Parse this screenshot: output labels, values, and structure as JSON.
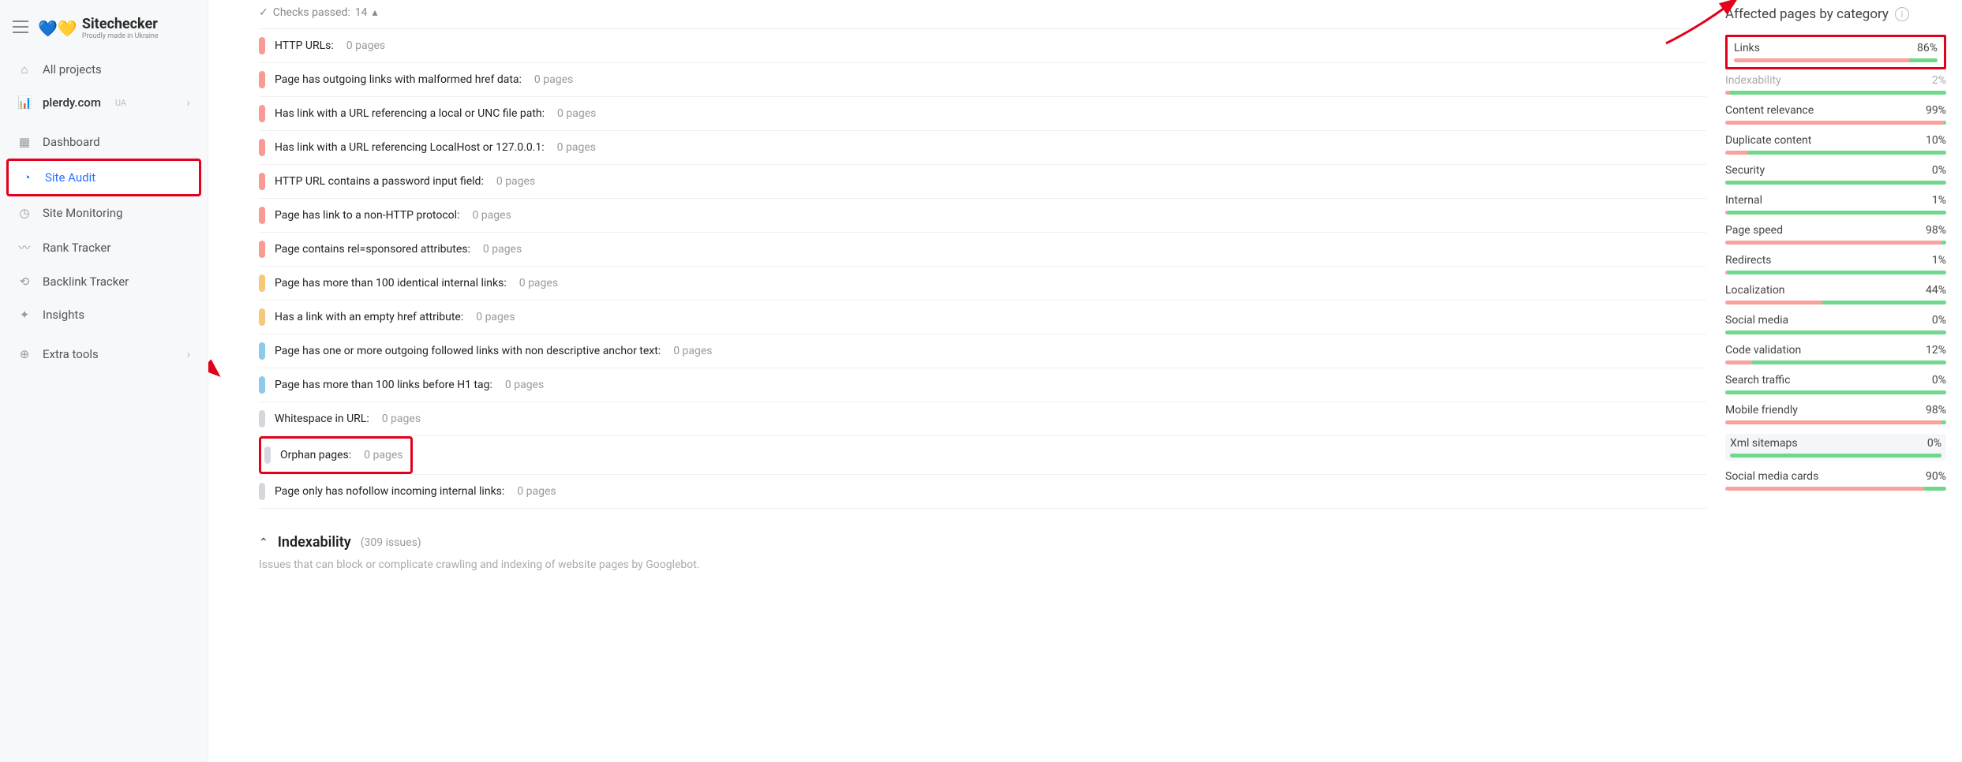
{
  "logo": {
    "title": "Sitechecker",
    "subtitle": "Proudly made in Ukraine"
  },
  "sidebar": {
    "all_projects": "All projects",
    "domain": "plerdy.com",
    "domain_tag": "UA",
    "items": [
      {
        "label": "Dashboard",
        "icon": "grid-icon"
      },
      {
        "label": "Site Audit",
        "icon": "gauge-icon",
        "active": true,
        "highlight": true
      },
      {
        "label": "Site Monitoring",
        "icon": "clock-icon"
      },
      {
        "label": "Rank Tracker",
        "icon": "trend-icon"
      },
      {
        "label": "Backlink Tracker",
        "icon": "link-icon"
      },
      {
        "label": "Insights",
        "icon": "wand-icon"
      }
    ],
    "extra": "Extra tools"
  },
  "checks_passed": {
    "label": "Checks passed:",
    "count": "14"
  },
  "checks": [
    {
      "sev": "red",
      "label": "HTTP URLs:",
      "count": "0 pages"
    },
    {
      "sev": "red",
      "label": "Page has outgoing links with malformed href data:",
      "count": "0 pages"
    },
    {
      "sev": "red",
      "label": "Has link with a URL referencing a local or UNC file path:",
      "count": "0 pages"
    },
    {
      "sev": "red",
      "label": "Has link with a URL referencing LocalHost or 127.0.0.1:",
      "count": "0 pages"
    },
    {
      "sev": "red",
      "label": "HTTP URL contains a password input field:",
      "count": "0 pages"
    },
    {
      "sev": "red",
      "label": "Page has link to a non-HTTP protocol:",
      "count": "0 pages"
    },
    {
      "sev": "red",
      "label": "Page contains rel=sponsored attributes:",
      "count": "0 pages"
    },
    {
      "sev": "orange",
      "label": "Page has more than 100 identical internal links:",
      "count": "0 pages"
    },
    {
      "sev": "orange",
      "label": "Has a link with an empty href attribute:",
      "count": "0 pages"
    },
    {
      "sev": "blue",
      "label": "Page has one or more outgoing followed links with non descriptive anchor text:",
      "count": "0 pages"
    },
    {
      "sev": "blue",
      "label": "Page has more than 100 links before H1 tag:",
      "count": "0 pages"
    },
    {
      "sev": "grey",
      "label": "Whitespace in URL:",
      "count": "0 pages"
    },
    {
      "sev": "grey",
      "label": "Orphan pages:",
      "count": "0 pages",
      "highlight": true
    },
    {
      "sev": "grey",
      "label": "Page only has nofollow incoming internal links:",
      "count": "0 pages"
    }
  ],
  "section": {
    "title": "Indexability",
    "issues": "(309 issues)",
    "desc": "Issues that can block or complicate crawling and indexing of website pages by Googlebot."
  },
  "right_title": "Affected pages by category",
  "categories": [
    {
      "name": "Links",
      "pct": 86,
      "highlight": true
    },
    {
      "name": "Indexability",
      "pct": 2,
      "dim": true
    },
    {
      "name": "Content relevance",
      "pct": 99
    },
    {
      "name": "Duplicate content",
      "pct": 10
    },
    {
      "name": "Security",
      "pct": 0
    },
    {
      "name": "Internal",
      "pct": 1
    },
    {
      "name": "Page speed",
      "pct": 98
    },
    {
      "name": "Redirects",
      "pct": 1
    },
    {
      "name": "Localization",
      "pct": 44
    },
    {
      "name": "Social media",
      "pct": 0
    },
    {
      "name": "Code validation",
      "pct": 12
    },
    {
      "name": "Search traffic",
      "pct": 0
    },
    {
      "name": "Mobile friendly",
      "pct": 98
    },
    {
      "name": "Xml sitemaps",
      "pct": 0,
      "sel": true
    },
    {
      "name": "Social media cards",
      "pct": 90
    }
  ],
  "chart_data": {
    "type": "bar",
    "title": "Affected pages by category",
    "categories": [
      "Links",
      "Indexability",
      "Content relevance",
      "Duplicate content",
      "Security",
      "Internal",
      "Page speed",
      "Redirects",
      "Localization",
      "Social media",
      "Code validation",
      "Search traffic",
      "Mobile friendly",
      "Xml sitemaps",
      "Social media cards"
    ],
    "values": [
      86,
      2,
      99,
      10,
      0,
      1,
      98,
      1,
      44,
      0,
      12,
      0,
      98,
      0,
      90
    ],
    "xlabel": "",
    "ylabel": "%",
    "ylim": [
      0,
      100
    ]
  }
}
